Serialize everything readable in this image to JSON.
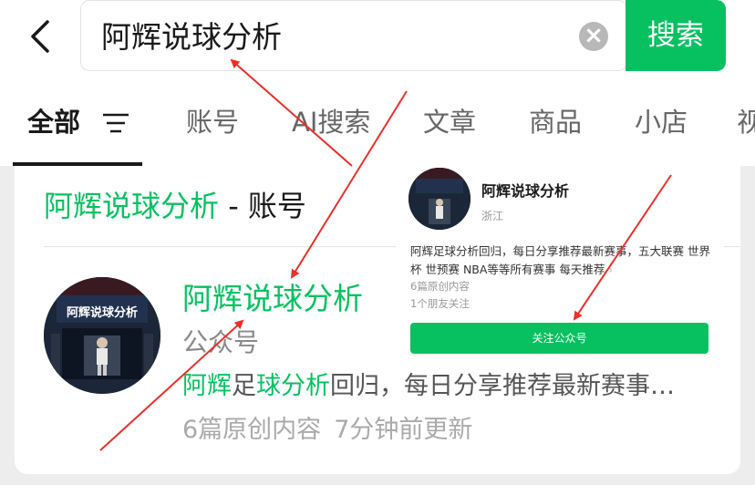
{
  "search": {
    "query": "阿辉说球分析",
    "button_label": "搜索"
  },
  "tabs": [
    {
      "label": "全部"
    },
    {
      "label": "账号"
    },
    {
      "label": "AI搜索"
    },
    {
      "label": "文章"
    },
    {
      "label": "商品"
    },
    {
      "label": "小店"
    },
    {
      "label": "视"
    }
  ],
  "section": {
    "title_highlight": "阿辉说球分析",
    "title_rest": " - 账号"
  },
  "account": {
    "avatar_text": "阿辉说球分析",
    "name": "阿辉说球分析",
    "type": "公众号",
    "desc_parts": [
      "阿辉",
      "足",
      "球分析",
      "回归，每日分享推荐最新赛事…"
    ],
    "original_count": "6篇原创内容",
    "updated": "7分钟前更新"
  },
  "popup": {
    "name": "阿辉说球分析",
    "location": "浙江",
    "description": "阿辉足球分析回归，每日分享推荐最新赛事，五大联赛 世界杯 世预赛 NBA等等所有赛事 每天推荐",
    "more_icon": "chevron-right-icon",
    "original_count": "6篇原创内容",
    "friends_follow": "1个朋友关注",
    "follow_button": "关注公众号"
  },
  "colors": {
    "accent": "#07c160",
    "arrow": "#e8312a"
  }
}
